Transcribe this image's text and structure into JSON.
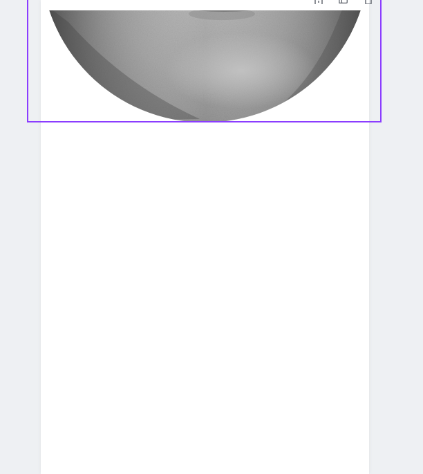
{
  "editor": {
    "selection_color": "#8b3dff",
    "canvas_background": "#eef0f3",
    "page_background": "#ffffff"
  },
  "toolbar": {
    "icons": [
      "lock-icon",
      "duplicate-icon",
      "delete-icon"
    ]
  },
  "image": {
    "shape": "circle",
    "tone": "grayscale"
  }
}
